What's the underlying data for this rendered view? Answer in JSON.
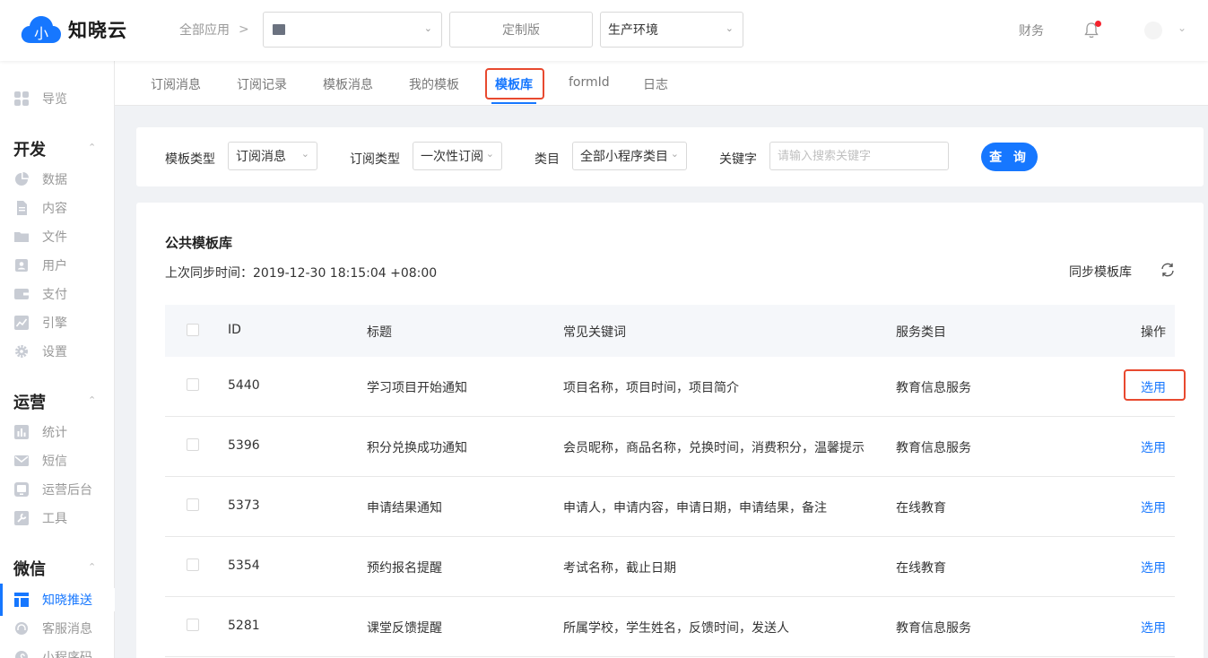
{
  "header": {
    "logo_mark": "小",
    "logo_text": "知晓云",
    "all_apps": "全部应用",
    "app_selector_value": "",
    "edition": "定制版",
    "environment": "生产环境",
    "finance": "财务",
    "icons": {
      "bell": "bell-icon",
      "notification_dot_color": "#f5222d"
    }
  },
  "sidebar": {
    "nav_item": "导览",
    "groups": [
      {
        "title": "开发",
        "items": [
          "数据",
          "内容",
          "文件",
          "用户",
          "支付",
          "引擎",
          "设置"
        ]
      },
      {
        "title": "运营",
        "items": [
          "统计",
          "短信",
          "运营后台",
          "工具"
        ]
      },
      {
        "title": "微信",
        "items": [
          "知晓推送",
          "客服消息",
          "小程序码"
        ]
      }
    ],
    "active_item": "知晓推送"
  },
  "tabs": [
    "订阅消息",
    "订阅记录",
    "模板消息",
    "我的模板",
    "模板库",
    "formId",
    "日志"
  ],
  "active_tab": "模板库",
  "filters": {
    "template_type_label": "模板类型",
    "template_type_value": "订阅消息",
    "subscribe_type_label": "订阅类型",
    "subscribe_type_value": "一次性订阅",
    "category_label": "类目",
    "category_value": "全部小程序类目",
    "keyword_label": "关键字",
    "keyword_placeholder": "请输入搜索关键字",
    "query_button": "查 询"
  },
  "library": {
    "title": "公共模板库",
    "last_sync": "上次同步时间：2019-12-30 18:15:04 +08:00",
    "sync_button": "同步模板库",
    "columns": [
      "ID",
      "标题",
      "常见关键词",
      "服务类目",
      "操作"
    ],
    "rows": [
      {
        "id": "5440",
        "title": "学习项目开始通知",
        "keywords": "项目名称，项目时间，项目简介",
        "category": "教育信息服务",
        "action": "选用"
      },
      {
        "id": "5396",
        "title": "积分兑换成功通知",
        "keywords": "会员昵称，商品名称，兑换时间，消费积分，温馨提示",
        "category": "教育信息服务",
        "action": "选用"
      },
      {
        "id": "5373",
        "title": "申请结果通知",
        "keywords": "申请人，申请内容，申请日期，申请结果，备注",
        "category": "在线教育",
        "action": "选用"
      },
      {
        "id": "5354",
        "title": "预约报名提醒",
        "keywords": "考试名称，截止日期",
        "category": "在线教育",
        "action": "选用"
      },
      {
        "id": "5281",
        "title": "课堂反馈提醒",
        "keywords": "所属学校，学生姓名，反馈时间，发送人",
        "category": "教育信息服务",
        "action": "选用"
      }
    ]
  },
  "colors": {
    "accent": "#1677ff",
    "highlight_box": "#e8492f"
  }
}
